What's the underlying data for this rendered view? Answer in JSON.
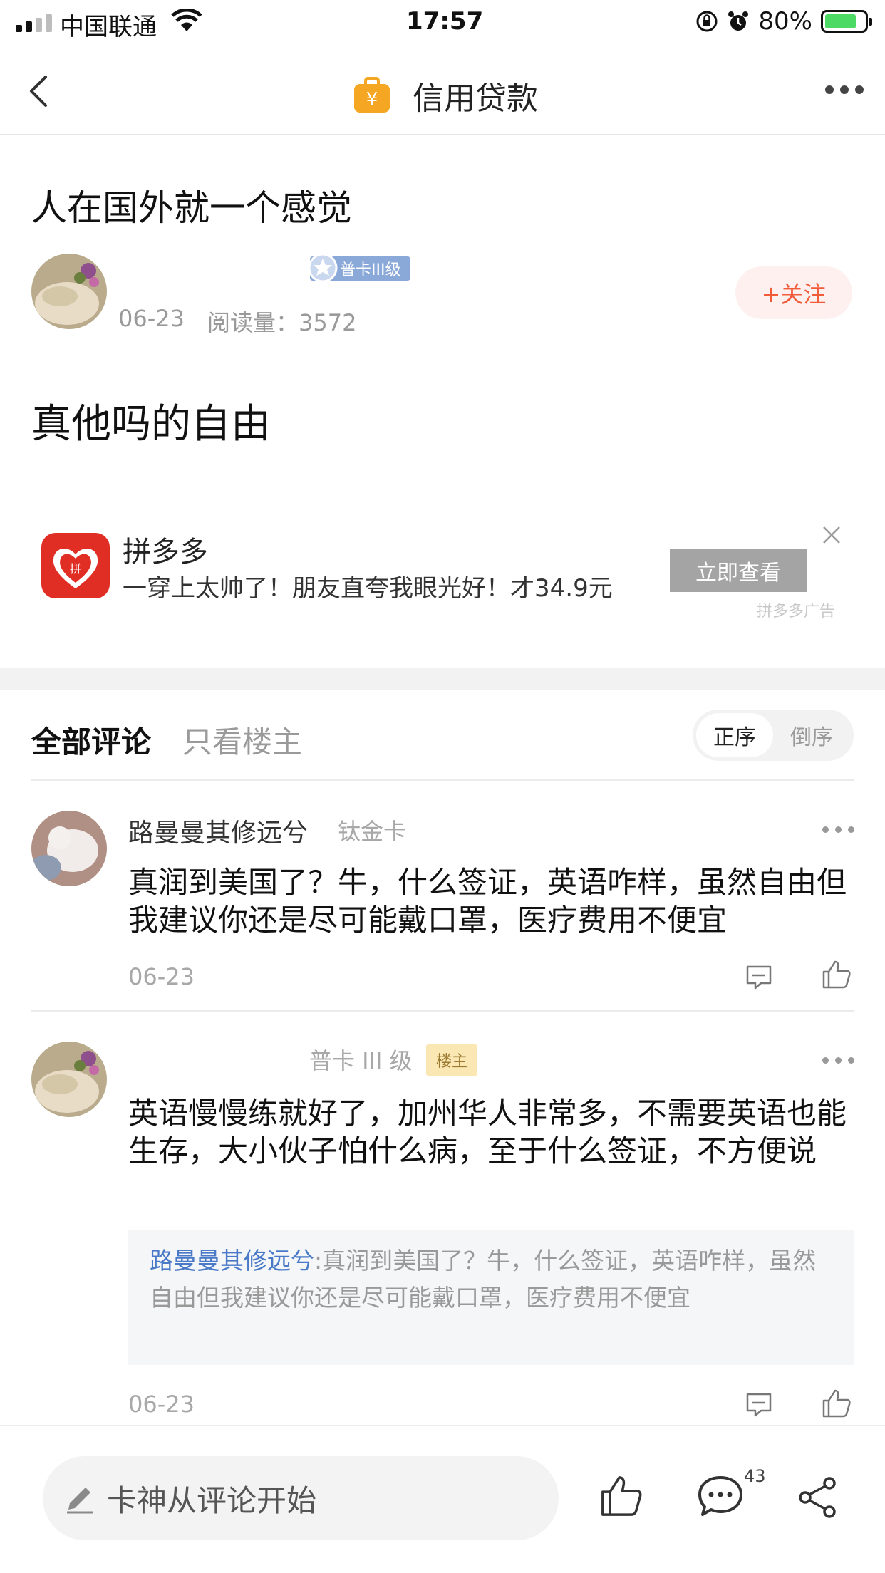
{
  "status_bar": {
    "carrier": "中国联通",
    "time": "17:57",
    "battery": "80%",
    "battery_level": 0.8
  },
  "nav": {
    "title": "信用贷款",
    "back_icon": "chevron-left-icon",
    "bag_icon": "money-bag-icon",
    "more_icon": "more-dots-icon"
  },
  "post": {
    "title": "人在国外就一个感觉",
    "level_badge": "普卡III级",
    "date": "06-23",
    "reads": "阅读量：3572",
    "follow_label": "+关注",
    "body": "真他吗的自由"
  },
  "ad": {
    "name": "拼多多",
    "desc": "一穿上太帅了！朋友直夸我眼光好！才34.9元",
    "button": "立即查看",
    "source": "拼多多广告"
  },
  "comments_header": {
    "tab_all": "全部评论",
    "tab_owner": "只看楼主",
    "sort_asc": "正序",
    "sort_desc": "倒序"
  },
  "comments": [
    {
      "name": "路曼曼其修远兮",
      "level": "钛金卡",
      "text": "真润到美国了？牛，什么签证，英语咋样，虽然自由但我建议你还是尽可能戴口罩，医疗费用不便宜",
      "date": "06-23"
    },
    {
      "level": "普卡 III 级",
      "owner_tag": "楼主",
      "text": "英语慢慢练就好了，加州华人非常多，不需要英语也能生存，大小伙子怕什么病，至于什么签证，不方便说",
      "quote_name": "路曼曼其修远兮",
      "quote_text": ":真润到美国了？牛，什么签证，英语咋样，虽然自由但我建议你还是尽可能戴口罩，医疗费用不便宜",
      "date": "06-23"
    }
  ],
  "bottom_bar": {
    "input_placeholder": "卡神从评论开始",
    "comment_count": "43"
  },
  "colors": {
    "accent": "#f25b3a",
    "link": "#4a7ac7",
    "ad_red": "#e02e24",
    "badge_blue": "#8aa8d8"
  }
}
